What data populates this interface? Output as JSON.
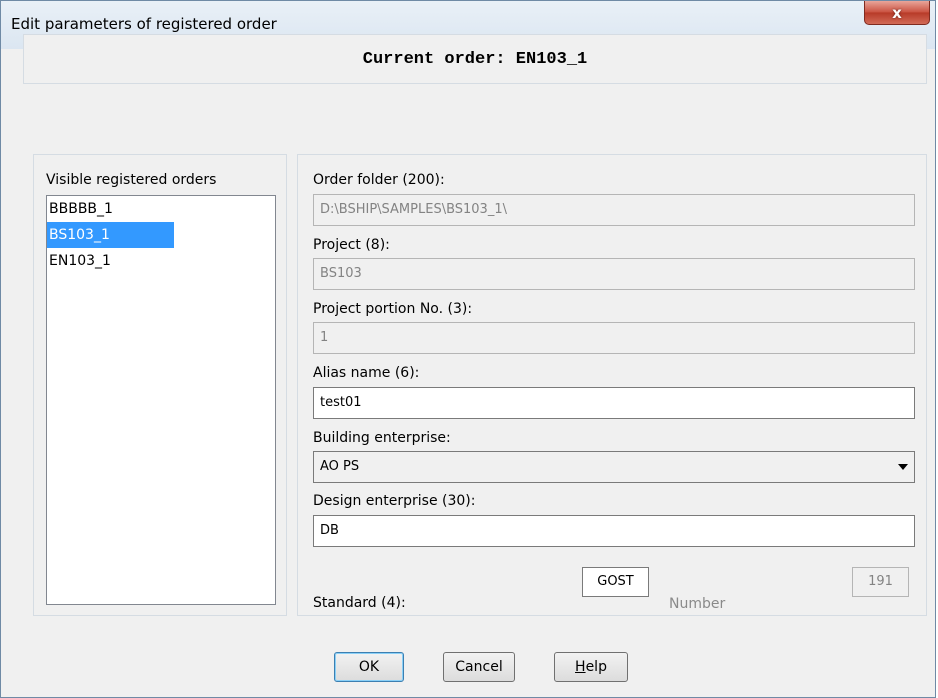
{
  "window": {
    "title": "Edit parameters of registered order",
    "close_label": "x"
  },
  "banner": {
    "text": "Current order: EN103_1"
  },
  "orders_list": {
    "label": "Visible registered orders",
    "items": [
      "BBBBB_1",
      "BS103_1",
      "EN103_1"
    ],
    "selected": "BS103_1"
  },
  "form": {
    "order_folder_label": "Order folder (200):",
    "order_folder_value": "D:\\BSHIP\\SAMPLES\\BS103_1\\",
    "project_label": "Project (8):",
    "project_value": "BS103",
    "portion_label": "Project portion No. (3):",
    "portion_value": "1",
    "alias_label": "Alias name (6):",
    "alias_value": "test01",
    "building_label": "Building enterprise:",
    "building_value": "AO PS",
    "design_label": "Design enterprise (30):",
    "design_value": "DB",
    "standard_label": "Standard (4):",
    "standard_value": "GOST",
    "number_label": "Number",
    "number_value": "191"
  },
  "buttons": {
    "ok": "OK",
    "cancel": "Cancel",
    "help_prefix": "H",
    "help_rest": "elp"
  },
  "colors": {
    "selection": "#3399ff",
    "close_button": "#c9503f"
  }
}
